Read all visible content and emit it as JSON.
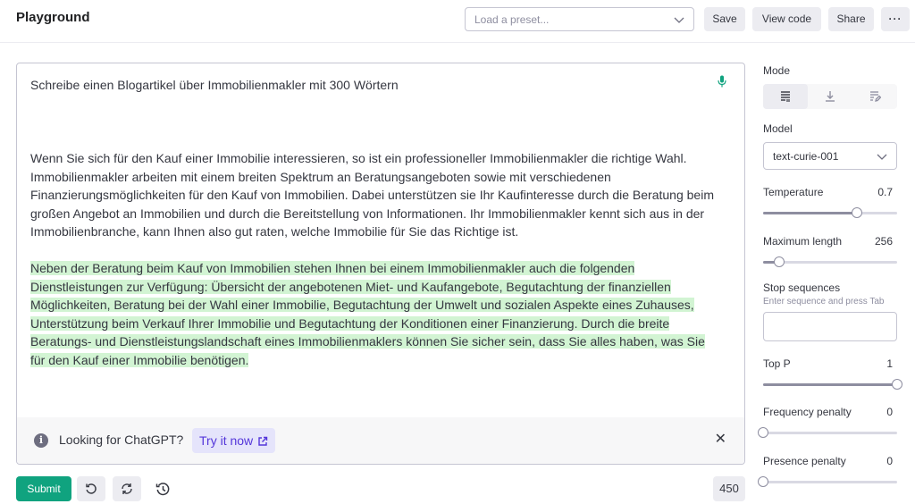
{
  "header": {
    "title": "Playground",
    "preset_placeholder": "Load a preset...",
    "save_label": "Save",
    "view_code_label": "View code",
    "share_label": "Share",
    "more_label": "···"
  },
  "editor": {
    "prompt": "Schreibe einen Blogartikel über Immobilienmakler mit 300 Wörtern",
    "output": "Wenn Sie sich für den Kauf einer Immobilie interessieren, so ist ein professioneller Immobilienmakler die richtige Wahl. Immobilienmakler arbeiten mit einem breiten Spektrum an Beratungsangeboten sowie mit verschiedenen Finanzierungsmöglichkeiten für den Kauf von Immobilien. Dabei unterstützen sie Ihr Kaufinteresse durch die Beratung beim großen Angebot an Immobilien und durch die Bereitstellung von Informationen. Ihr Immobilienmakler kennt sich aus in der Immobilienbranche, kann Ihnen also gut raten, welche Immobilie für Sie das Richtige ist.",
    "completion": "Neben der Beratung beim Kauf von Immobilien stehen Ihnen bei einem Immobilienmakler auch die folgenden Dienstleistungen zur Verfügung: Übersicht der angebotenen Miet- und Kaufangebote, Begutachtung der finanziellen Möglichkeiten, Beratung bei der Wahl einer Immobilie, Begutachtung der Umwelt und sozialen Aspekte eines Zuhauses, Unterstützung beim Verkauf Ihrer Immobilie und Begutachtung der Konditionen einer Finanzierung. Durch die breite Beratungs- und Dienstleistungslandschaft eines Immobilienmaklers können Sie sicher sein, dass Sie alles haben, was Sie für den Kauf einer Immobilie benötigen.",
    "highlight_color": "#d2f4d3"
  },
  "banner": {
    "text": "Looking for ChatGPT?",
    "link_label": "Try it now",
    "close_label": "✕"
  },
  "footer": {
    "submit_label": "Submit",
    "token_count": "450",
    "accent_color": "#10a37f"
  },
  "sidebar": {
    "mode_label": "Mode",
    "modes": [
      {
        "icon": "complete-icon",
        "active": true
      },
      {
        "icon": "insert-icon",
        "active": false
      },
      {
        "icon": "edit-icon",
        "active": false
      }
    ],
    "model_label": "Model",
    "model_value": "text-curie-001",
    "temperature": {
      "label": "Temperature",
      "value": "0.7",
      "fraction": 0.7
    },
    "max_length": {
      "label": "Maximum length",
      "value": "256",
      "fraction": 0.12
    },
    "stop_sequences": {
      "label": "Stop sequences",
      "hint": "Enter sequence and press Tab"
    },
    "top_p": {
      "label": "Top P",
      "value": "1",
      "fraction": 1.0
    },
    "frequency_penalty": {
      "label": "Frequency penalty",
      "value": "0",
      "fraction": 0.0
    },
    "presence_penalty": {
      "label": "Presence penalty",
      "value": "0",
      "fraction": 0.0
    }
  }
}
